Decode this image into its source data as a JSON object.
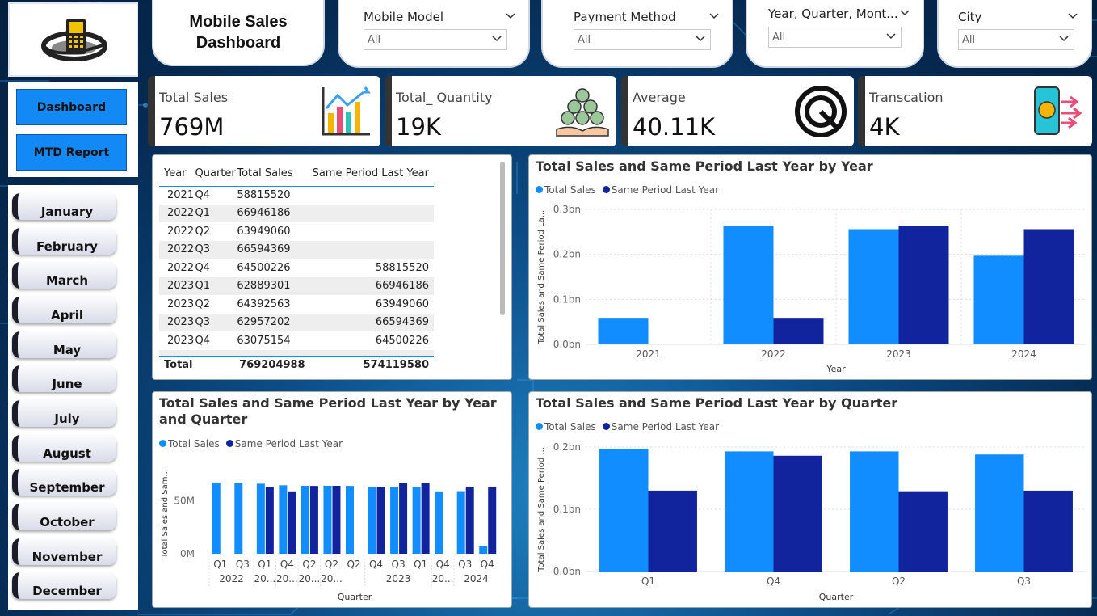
{
  "title": "Mobile Sales Dashboard",
  "nav": {
    "dashboard": "Dashboard",
    "mtd": "MTD Report"
  },
  "months": [
    "January",
    "February",
    "March",
    "April",
    "May",
    "June",
    "July",
    "August",
    "September",
    "October",
    "November",
    "December"
  ],
  "slicers": [
    {
      "label": "Mobile Model",
      "value": "All"
    },
    {
      "label": "Payment Method",
      "value": "All"
    },
    {
      "label": "Year, Quarter, Mont...",
      "value": "All"
    },
    {
      "label": "City",
      "value": "All"
    }
  ],
  "kpis": [
    {
      "label": "Total Sales",
      "value": "769M",
      "icon": "growth-chart-icon"
    },
    {
      "label": "Total_ Quantity",
      "value": "19K",
      "icon": "coins-in-hand-icon"
    },
    {
      "label": "Average",
      "value": "40.11K",
      "icon": "average-gauge-icon"
    },
    {
      "label": "Transcation",
      "value": "4K",
      "icon": "mobile-payment-icon"
    }
  ],
  "table": {
    "headers": [
      "Year",
      "Quarter",
      "Total Sales",
      "Same Period Last Year"
    ],
    "rows": [
      [
        "2021",
        "Q4",
        "58815520",
        ""
      ],
      [
        "2022",
        "Q1",
        "66946186",
        ""
      ],
      [
        "2022",
        "Q2",
        "63949060",
        ""
      ],
      [
        "2022",
        "Q3",
        "66594369",
        ""
      ],
      [
        "2022",
        "Q4",
        "64500226",
        "58815520"
      ],
      [
        "2023",
        "Q1",
        "62889301",
        "66946186"
      ],
      [
        "2023",
        "Q2",
        "64392563",
        "63949060"
      ],
      [
        "2023",
        "Q3",
        "62957202",
        "66594369"
      ],
      [
        "2023",
        "Q4",
        "63075154",
        "64500226"
      ]
    ],
    "total": {
      "label": "Total",
      "sales": "769204988",
      "last": "574119580"
    }
  },
  "colors": {
    "total_sales": "#118dff",
    "same_period": "#12239e"
  },
  "legend": {
    "total_sales": "Total Sales",
    "same_period": "Same Period Last Year"
  },
  "chart_data": [
    {
      "type": "bar",
      "title": "Total Sales and Same Period Last Year by Year",
      "categories": [
        "2021",
        "2022",
        "2023",
        "2024"
      ],
      "series": [
        {
          "name": "Total Sales",
          "values": [
            0.059,
            0.264,
            0.256,
            0.197
          ]
        },
        {
          "name": "Same Period Last Year",
          "values": [
            0,
            0.059,
            0.264,
            0.256
          ]
        }
      ],
      "xlabel": "Year",
      "ylabel": "Total Sales and Same Period La...",
      "yticks": [
        "0.0bn",
        "0.1bn",
        "0.2bn",
        "0.3bn"
      ],
      "ylim": [
        0,
        0.3
      ]
    },
    {
      "type": "bar",
      "title": "Total Sales and Same Period Last Year by Year and Quarter",
      "categories": [
        "Q1",
        "Q3",
        "Q1",
        "Q4",
        "Q2",
        "Q2",
        "Q2",
        "Q4",
        "Q3",
        "Q1",
        "Q4",
        "Q3",
        "Q4"
      ],
      "groups": [
        "2022",
        "20...",
        "20...",
        "20...",
        "20...",
        "2023",
        "20...",
        "2024"
      ],
      "series": [
        {
          "name": "Total Sales",
          "values": [
            66.9,
            66.6,
            66.0,
            64.5,
            64.0,
            64.0,
            63.9,
            63.1,
            63.0,
            62.9,
            58.8,
            59.0,
            7.0
          ]
        },
        {
          "name": "Same Period Last Year",
          "values": [
            0,
            0,
            62.9,
            58.8,
            63.9,
            64.0,
            0,
            63.1,
            66.6,
            66.9,
            0,
            63.0,
            63.1
          ]
        }
      ],
      "xlabel": "Quarter",
      "ylabel": "Total Sales and Sam...",
      "yticks": [
        "0M",
        "50M"
      ],
      "ylim": [
        0,
        80
      ]
    },
    {
      "type": "bar",
      "title": "Total Sales and Same Period Last Year by Quarter",
      "categories": [
        "Q1",
        "Q4",
        "Q2",
        "Q3"
      ],
      "series": [
        {
          "name": "Total Sales",
          "values": [
            0.197,
            0.193,
            0.193,
            0.188
          ]
        },
        {
          "name": "Same Period Last Year",
          "values": [
            0.13,
            0.186,
            0.129,
            0.13
          ]
        }
      ],
      "xlabel": "Quarter",
      "ylabel": "Total Sales and Same Period ...",
      "yticks": [
        "0.0bn",
        "0.1bn",
        "0.2bn"
      ],
      "ylim": [
        0,
        0.2
      ]
    }
  ]
}
